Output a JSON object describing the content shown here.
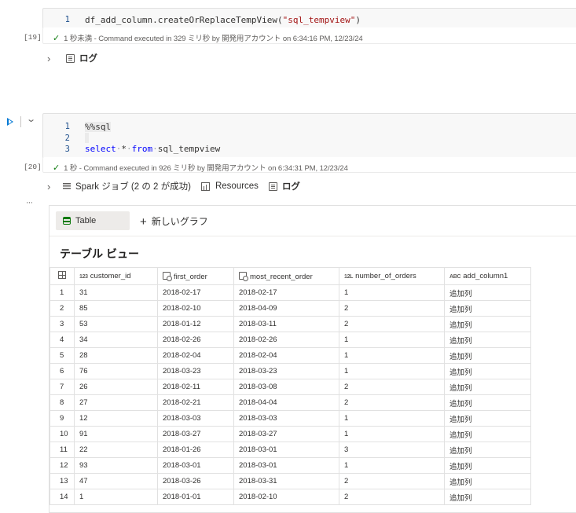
{
  "cell19": {
    "exec_count": "[19]",
    "lines": [
      {
        "num": "1",
        "code_pre": "df_add_column.createOrReplaceTempView(",
        "code_str": "\"sql_tempview\"",
        "code_post": ")"
      }
    ],
    "status": "1 秒未満 - Command executed in 329 ミリ秒 by 開発用アカウント on 6:34:16 PM, 12/23/24",
    "log_label": "ログ"
  },
  "cell20": {
    "exec_count": "[20]",
    "line1": {
      "num": "1",
      "code": "%%sql"
    },
    "line2": {
      "num": "2",
      "code": ""
    },
    "line3": {
      "num": "3",
      "kw1": "select",
      "star": "*",
      "kw2": "from",
      "rest": "sql_tempview"
    },
    "status": "1 秒 - Command executed in 926 ミリ秒 by 開発用アカウント on 6:34:31 PM, 12/23/24",
    "spark_label": "Spark ジョブ (2 の 2 が成功)",
    "resources_label": "Resources",
    "log_label": "ログ",
    "more": "···"
  },
  "output": {
    "tab_table": "Table",
    "new_graph": "新しいグラフ",
    "view_title": "テーブル ビュー",
    "columns": [
      {
        "type": "123",
        "name": "customer_id"
      },
      {
        "type": "date",
        "name": "first_order"
      },
      {
        "type": "date",
        "name": "most_recent_order"
      },
      {
        "type": "12L",
        "name": "number_of_orders"
      },
      {
        "type": "ABC",
        "name": "add_column1"
      }
    ],
    "rows": [
      [
        "1",
        "31",
        "2018-02-17",
        "2018-02-17",
        "1",
        "追加列"
      ],
      [
        "2",
        "85",
        "2018-02-10",
        "2018-04-09",
        "2",
        "追加列"
      ],
      [
        "3",
        "53",
        "2018-01-12",
        "2018-03-11",
        "2",
        "追加列"
      ],
      [
        "4",
        "34",
        "2018-02-26",
        "2018-02-26",
        "1",
        "追加列"
      ],
      [
        "5",
        "28",
        "2018-02-04",
        "2018-02-04",
        "1",
        "追加列"
      ],
      [
        "6",
        "76",
        "2018-03-23",
        "2018-03-23",
        "1",
        "追加列"
      ],
      [
        "7",
        "26",
        "2018-02-11",
        "2018-03-08",
        "2",
        "追加列"
      ],
      [
        "8",
        "27",
        "2018-02-21",
        "2018-04-04",
        "2",
        "追加列"
      ],
      [
        "9",
        "12",
        "2018-03-03",
        "2018-03-03",
        "1",
        "追加列"
      ],
      [
        "10",
        "91",
        "2018-03-27",
        "2018-03-27",
        "1",
        "追加列"
      ],
      [
        "11",
        "22",
        "2018-01-26",
        "2018-03-01",
        "3",
        "追加列"
      ],
      [
        "12",
        "93",
        "2018-03-01",
        "2018-03-01",
        "1",
        "追加列"
      ],
      [
        "13",
        "47",
        "2018-03-26",
        "2018-03-31",
        "2",
        "追加列"
      ],
      [
        "14",
        "1",
        "2018-01-01",
        "2018-02-10",
        "2",
        "追加列"
      ]
    ]
  },
  "colors": {
    "accent": "#0078d4",
    "success": "#107c10",
    "keyword": "#0000ff",
    "string": "#a31515"
  }
}
